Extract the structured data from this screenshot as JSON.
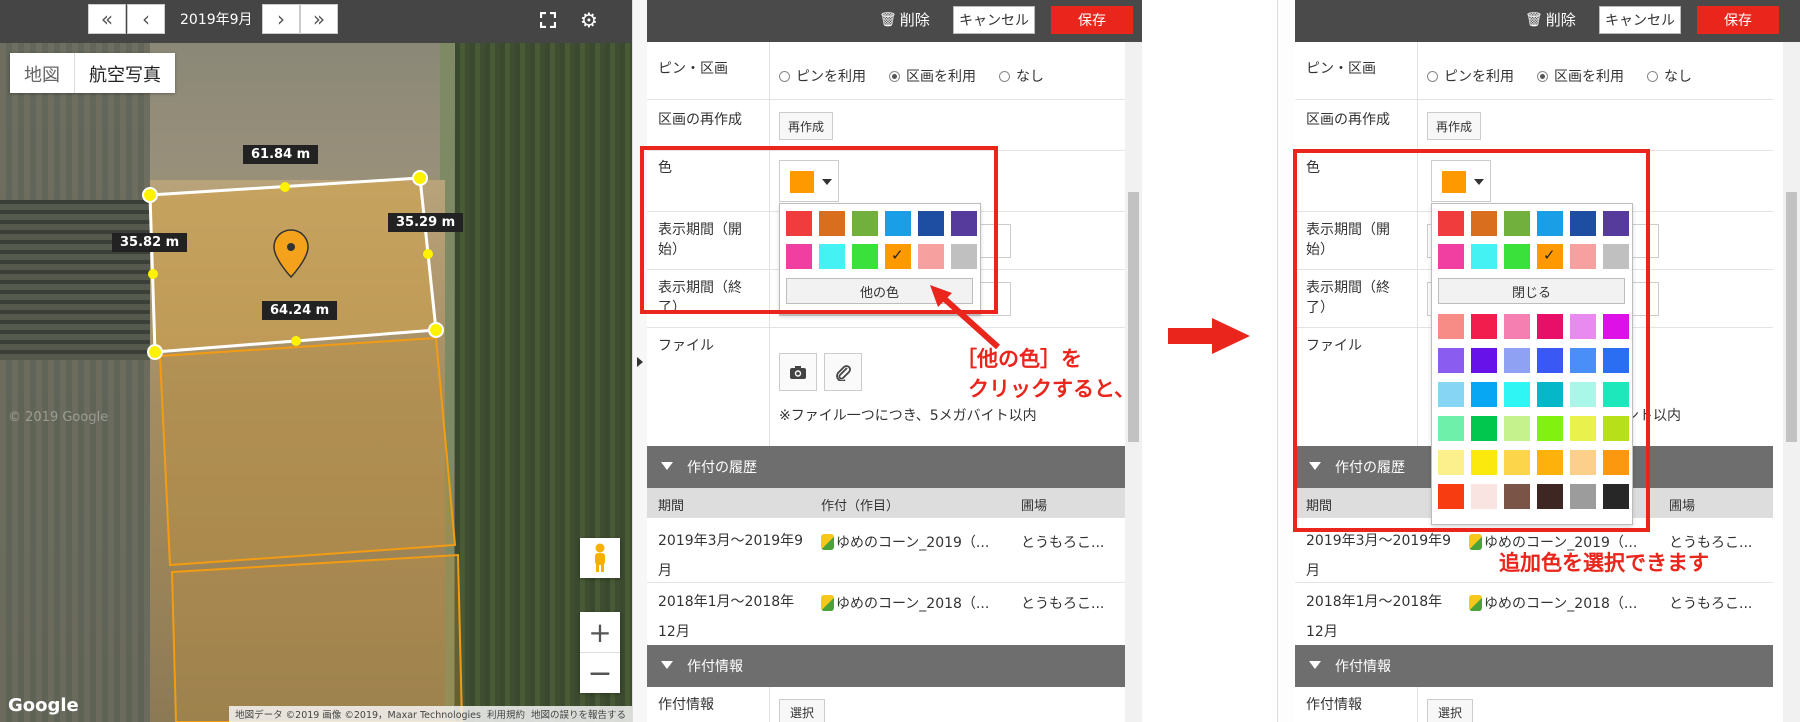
{
  "map": {
    "date_label": "2019年9月",
    "type_tabs": [
      "地図",
      "航空写真"
    ],
    "measurements": [
      "61.84 m",
      "35.82 m",
      "35.29 m",
      "64.24 m"
    ],
    "watermark": "© 2019 Google",
    "google_logo": "Google",
    "attribution": [
      "地図データ ©2019 画像 ©2019，Maxar Technologies",
      "利用規約",
      "地図の誤りを報告する"
    ]
  },
  "panel": {
    "delete_label": "削除",
    "cancel_label": "キャンセル",
    "save_label": "保存",
    "pin_area_label": "ピン・区画",
    "radio_options": [
      "ピンを利用",
      "区画を利用",
      "なし"
    ],
    "radio_selected": "区画を利用",
    "recreate_label": "区画の再作成",
    "recreate_button": "再作成",
    "color_label": "色",
    "selected_color": "#ff9900",
    "period_start_label_1": "表示期間（開",
    "period_start_label_2": "始）",
    "period_end_label_1": "表示期間（終",
    "period_end_label_2": "了）",
    "file_label": "ファイル",
    "file_note": "※ファイル一つにつき、5メガバイト以内",
    "file_note_partial": "ント以内",
    "history_title": "作付の履歴",
    "history_headers": [
      "期間",
      "作付（作目）",
      "圃場"
    ],
    "history_rows": [
      {
        "period_1": "2019年3月〜2019年9",
        "period_2": "月",
        "crop": "ゆめのコーン_2019（...",
        "field": "とうもろこ..."
      },
      {
        "period_1": "2018年1月〜2018年",
        "period_2": "12月",
        "crop": "ゆめのコーン_2018（...",
        "field": "とうもろこ..."
      }
    ],
    "info_title": "作付情報",
    "info_label": "作付情報",
    "info_button": "選択"
  },
  "palette": {
    "basic_colors": [
      "#f03c3c",
      "#d86e1e",
      "#72b03e",
      "#1a9ee6",
      "#1d4ea2",
      "#563a9c",
      "#f03fa0",
      "#44f2f4",
      "#3ae13a",
      "#ff9900",
      "#f6a0a0",
      "#c0c0c0"
    ],
    "selected_index": 9,
    "more_colors_button": "他の色",
    "close_button": "閉じる",
    "extra_colors": [
      "#f78b86",
      "#f21d4c",
      "#f47fb0",
      "#e80f68",
      "#e88af0",
      "#dd10e8",
      "#8a5cf0",
      "#6712e8",
      "#8ea1f3",
      "#3a59f4",
      "#4a8ff7",
      "#2a6ff2",
      "#87d5f5",
      "#08a7f4",
      "#2ff5f5",
      "#06b6c9",
      "#a8f7e9",
      "#1de8bc",
      "#6ef0ab",
      "#02c74f",
      "#c6f28d",
      "#81f20f",
      "#e9f24c",
      "#b7e01a",
      "#fbf08b",
      "#fbe80c",
      "#fdd54a",
      "#fdb10b",
      "#fcd08a",
      "#fb9810",
      "#f73c12",
      "#fae4e2",
      "#7a5446",
      "#3e2722",
      "#9c9c9c",
      "#272727"
    ]
  },
  "annotations": {
    "click_line1": "［他の色］を",
    "click_line2": "クリックすると、",
    "result": "追加色を選択できます"
  }
}
